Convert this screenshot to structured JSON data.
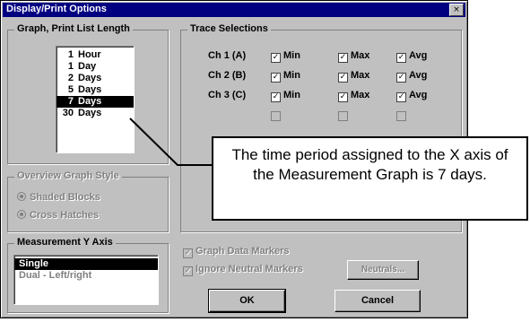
{
  "dialog": {
    "title": "Display/Print Options",
    "close_glyph": "×"
  },
  "graph_length": {
    "label": "Graph, Print List Length",
    "items": [
      {
        "num": "1",
        "unit": "Hour",
        "selected": false
      },
      {
        "num": "1",
        "unit": "Day",
        "selected": false
      },
      {
        "num": "2",
        "unit": "Days",
        "selected": false
      },
      {
        "num": "5",
        "unit": "Days",
        "selected": false
      },
      {
        "num": "7",
        "unit": "Days",
        "selected": true
      },
      {
        "num": "30",
        "unit": "Days",
        "selected": false
      }
    ]
  },
  "trace_selections": {
    "label": "Trace Selections",
    "rows": [
      {
        "channel": "Ch 1 (A)",
        "min": "Min",
        "max": "Max",
        "avg": "Avg"
      },
      {
        "channel": "Ch 2 (B)",
        "min": "Min",
        "max": "Max",
        "avg": "Avg"
      },
      {
        "channel": "Ch 3 (C)",
        "min": "Min",
        "max": "Max",
        "avg": "Avg"
      }
    ]
  },
  "overview_style": {
    "label": "Overview Graph Style",
    "options": [
      "Shaded Blocks",
      "Cross Hatches"
    ]
  },
  "measurement_y_axis": {
    "label": "Measurement Y Axis",
    "items": [
      "Single",
      "Dual - Left/right"
    ],
    "selected_index": 0
  },
  "graph_data_markers": {
    "label": "Graph Data Markers"
  },
  "ignore_neutral_markers": {
    "label": "Ignore Neutral Markers"
  },
  "neutrals_button": {
    "label": "Neutrals..."
  },
  "ok_button": {
    "label": "OK"
  },
  "cancel_button": {
    "label": "Cancel"
  },
  "callout": {
    "text": "The time period assigned to the X axis of the Measurement Graph is 7 days."
  }
}
